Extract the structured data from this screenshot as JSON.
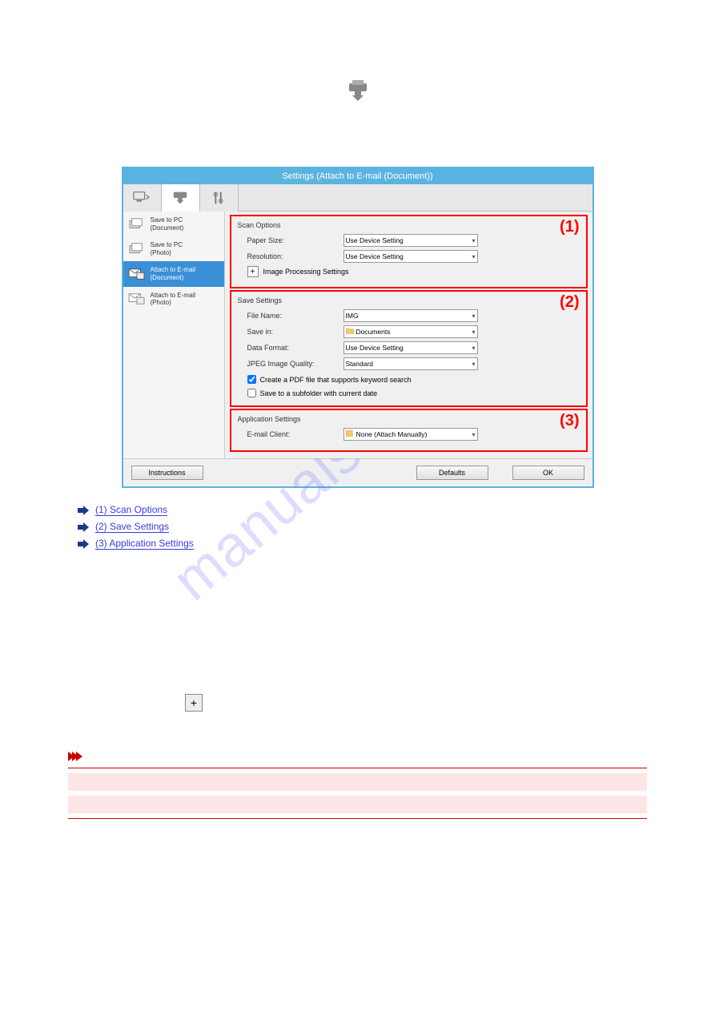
{
  "watermark": "manualshive.com",
  "dialog": {
    "title": "Settings (Attach to E-mail (Document))",
    "sidebar": [
      {
        "line1": "Save to PC",
        "line2": "(Document)"
      },
      {
        "line1": "Save to PC",
        "line2": "(Photo)"
      },
      {
        "line1": "Attach to E-mail",
        "line2": "(Document)"
      },
      {
        "line1": "Attach to E-mail",
        "line2": "(Photo)"
      }
    ],
    "scan_options": {
      "title": "Scan Options",
      "paper_size_label": "Paper Size:",
      "paper_size_value": "Use Device Setting",
      "resolution_label": "Resolution:",
      "resolution_value": "Use Device Setting",
      "image_processing": "Image Processing Settings",
      "badge": "(1)"
    },
    "save_settings": {
      "title": "Save Settings",
      "file_name_label": "File Name:",
      "file_name_value": "IMG",
      "save_in_label": "Save in:",
      "save_in_value": "Documents",
      "data_format_label": "Data Format:",
      "data_format_value": "Use Device Setting",
      "jpeg_label": "JPEG Image Quality:",
      "jpeg_value": "Standard",
      "cb_pdf": "Create a PDF file that supports keyword search",
      "cb_subfolder": "Save to a subfolder with current date",
      "badge": "(2)"
    },
    "app_settings": {
      "title": "Application Settings",
      "email_label": "E-mail Client:",
      "email_value": "None (Attach Manually)",
      "badge": "(3)"
    },
    "buttons": {
      "instructions": "Instructions",
      "defaults": "Defaults",
      "ok": "OK"
    }
  },
  "links": {
    "l1": "(1) Scan Options",
    "l2": "(2) Save Settings",
    "l3": "(3) Application Settings"
  },
  "plus_symbol": "+"
}
